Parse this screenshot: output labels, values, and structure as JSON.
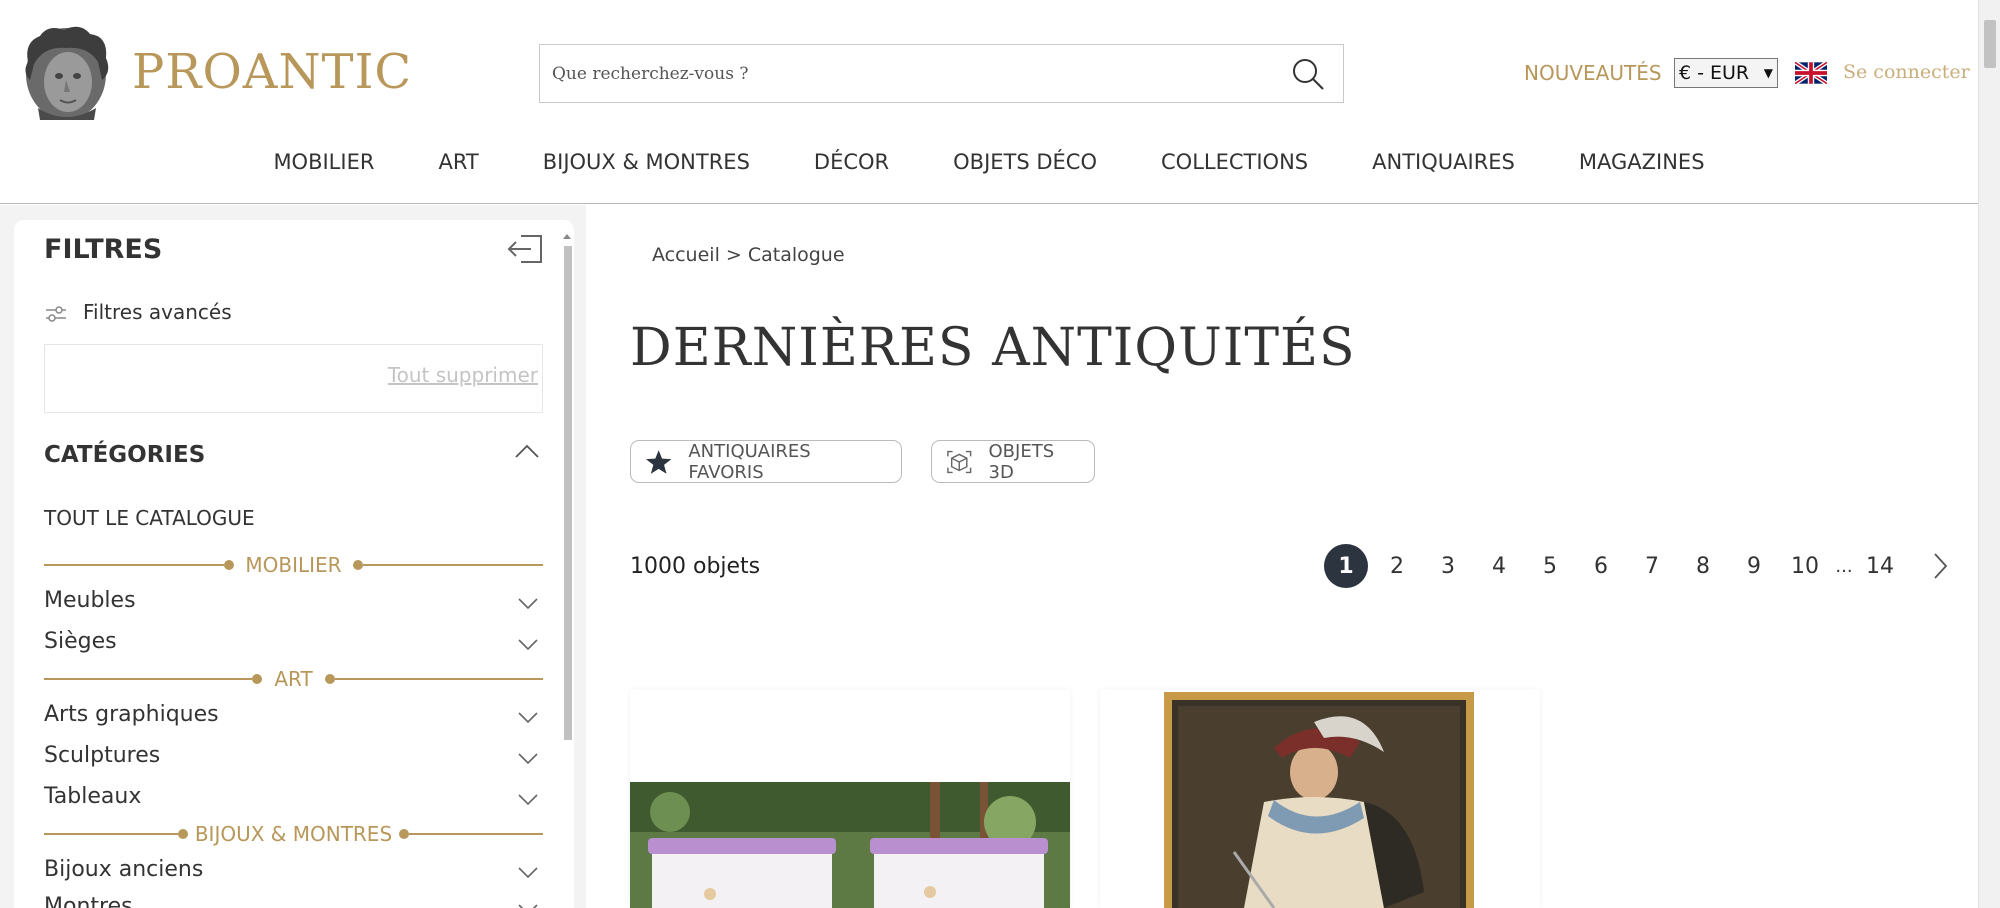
{
  "header": {
    "logo_text": "PROANTIC",
    "search_placeholder": "Que recherchez-vous ?",
    "nouveautes": "NOUVEAUTÉS",
    "currency": "€ - EUR",
    "signin": "Se connecter"
  },
  "nav": [
    "MOBILIER",
    "ART",
    "BIJOUX & MONTRES",
    "DÉCOR",
    "OBJETS DÉCO",
    "COLLECTIONS",
    "ANTIQUAIRES",
    "MAGAZINES"
  ],
  "sidebar": {
    "title": "FILTRES",
    "advanced": "Filtres avancés",
    "clear_all": "Tout supprimer",
    "categories_title": "CATÉGORIES",
    "all_catalog": "TOUT LE CATALOGUE",
    "sections": {
      "mobilier": "MOBILIER",
      "art": "ART",
      "bijoux": "BIJOUX & MONTRES"
    },
    "items": {
      "meubles": "Meubles",
      "sieges": "Sièges",
      "arts_graphiques": "Arts graphiques",
      "sculptures": "Sculptures",
      "tableaux": "Tableaux",
      "bijoux_anciens": "Bijoux anciens",
      "montres": "Montres"
    }
  },
  "main": {
    "breadcrumb": "Accueil > Catalogue",
    "title": "DERNIÈRES ANTIQUITÉS",
    "pill_favorites": "ANTIQUAIRES FAVORIS",
    "pill_3d": "OBJETS 3D",
    "count": "1000 objets",
    "pages": [
      "1",
      "2",
      "3",
      "4",
      "5",
      "6",
      "7",
      "8",
      "9",
      "10",
      "...",
      "14"
    ],
    "current_page": "1"
  },
  "colors": {
    "gold": "#b8975a",
    "dark": "#2c3440"
  }
}
